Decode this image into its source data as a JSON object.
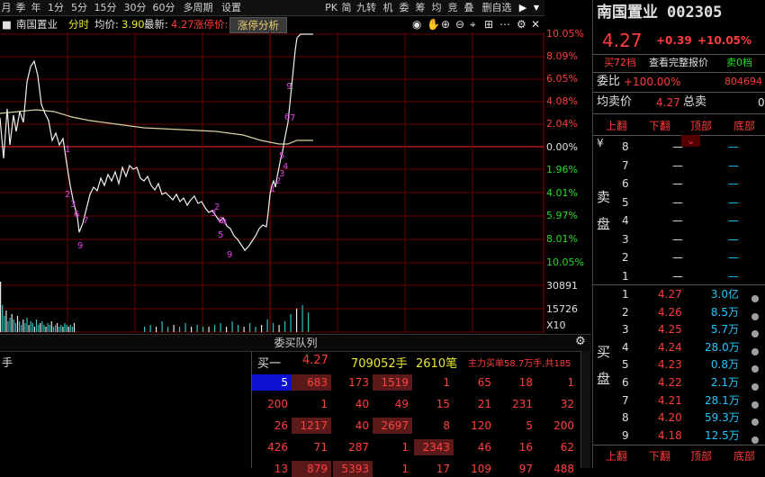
{
  "toolbar": {
    "items": [
      "月",
      "季",
      "年",
      "1分",
      "5分",
      "15分",
      "30分",
      "60分",
      "多周期",
      "设置"
    ],
    "right_items": [
      "PK",
      "简",
      "九转",
      "机",
      "委",
      "筹",
      "均",
      "竞",
      "叠",
      "删自选"
    ]
  },
  "infobar": {
    "stock_name": "南国置业",
    "mode": "分时",
    "avg_label": "均价:",
    "avg_value": "3.90",
    "latest_label": "最新:",
    "latest_value": "4.27",
    "limit_label": "涨停价:",
    "limit_button": "涨停分析"
  },
  "axis_right": {
    "pct_labels": [
      "10.05%",
      "8.09%",
      "6.05%",
      "4.08%",
      "2.04%",
      "0.00%",
      "1.96%",
      "4.01%",
      "5.97%",
      "8.01%",
      "10.05%"
    ],
    "vol_labels": [
      "30891",
      "15726",
      "X10"
    ]
  },
  "chart_marks": [
    "1",
    "2",
    "3",
    "6",
    "7",
    "9",
    "1",
    "2",
    "3",
    "4",
    "5",
    "6",
    "9",
    "1",
    "2",
    "3",
    "4",
    "5",
    "6",
    "7",
    "9"
  ],
  "queue": {
    "title": "委买队列",
    "left_label": "手",
    "header": {
      "label": "买一",
      "price": "4.27",
      "volume": "709052手",
      "count": "2610笔",
      "note": "主力买单58.7万手,共185"
    },
    "rows": [
      [
        "5",
        "683",
        "173",
        "1519",
        "1",
        "65",
        "18",
        "1"
      ],
      [
        "200",
        "1",
        "40",
        "49",
        "15",
        "21",
        "231",
        "32"
      ],
      [
        "26",
        "1217",
        "40",
        "2697",
        "8",
        "120",
        "5",
        "200"
      ],
      [
        "426",
        "71",
        "287",
        "1",
        "2343",
        "46",
        "16",
        "62"
      ],
      [
        "13",
        "879",
        "5393",
        "1",
        "17",
        "109",
        "97",
        "488"
      ]
    ]
  },
  "right_panel": {
    "name": "南国置业",
    "code": "002305",
    "price": "4.27",
    "change": "+0.39",
    "change_pct": "+10.05%",
    "btn_buy": "买72档",
    "btn_quote": "查看完整报价",
    "btn_sell": "卖0档",
    "weibi_label": "委比",
    "weibi_value": "+100.00%",
    "weibi_extra": "804694",
    "junmai_label": "均卖价",
    "junmai_value": "4.27",
    "zongmai_label": "总卖",
    "zongmai_value": "0",
    "nav": [
      "上翻",
      "下翻",
      "顶部",
      "底部"
    ],
    "currency": "¥",
    "sell_label_1": "卖",
    "sell_label_2": "盘",
    "buy_label_1": "买",
    "buy_label_2": "盘",
    "sell_levels": [
      {
        "lvl": "8",
        "price": "—",
        "vol": "—"
      },
      {
        "lvl": "7",
        "price": "—",
        "vol": "—"
      },
      {
        "lvl": "6",
        "price": "—",
        "vol": "—"
      },
      {
        "lvl": "5",
        "price": "—",
        "vol": "—"
      },
      {
        "lvl": "4",
        "price": "—",
        "vol": "—"
      },
      {
        "lvl": "3",
        "price": "—",
        "vol": "—"
      },
      {
        "lvl": "2",
        "price": "—",
        "vol": "—"
      },
      {
        "lvl": "1",
        "price": "—",
        "vol": "—"
      }
    ],
    "buy_levels": [
      {
        "lvl": "1",
        "price": "4.27",
        "vol": "3.0亿"
      },
      {
        "lvl": "2",
        "price": "4.26",
        "vol": "8.5万"
      },
      {
        "lvl": "3",
        "price": "4.25",
        "vol": "5.7万"
      },
      {
        "lvl": "4",
        "price": "4.24",
        "vol": "28.0万"
      },
      {
        "lvl": "5",
        "price": "4.23",
        "vol": "0.8万"
      },
      {
        "lvl": "6",
        "price": "4.22",
        "vol": "2.1万"
      },
      {
        "lvl": "7",
        "price": "4.21",
        "vol": "28.1万"
      },
      {
        "lvl": "8",
        "price": "4.20",
        "vol": "59.3万"
      },
      {
        "lvl": "9",
        "price": "4.18",
        "vol": "12.5万"
      }
    ],
    "nav_bottom": [
      "上翻",
      "下翻",
      "顶部",
      "底部"
    ]
  }
}
